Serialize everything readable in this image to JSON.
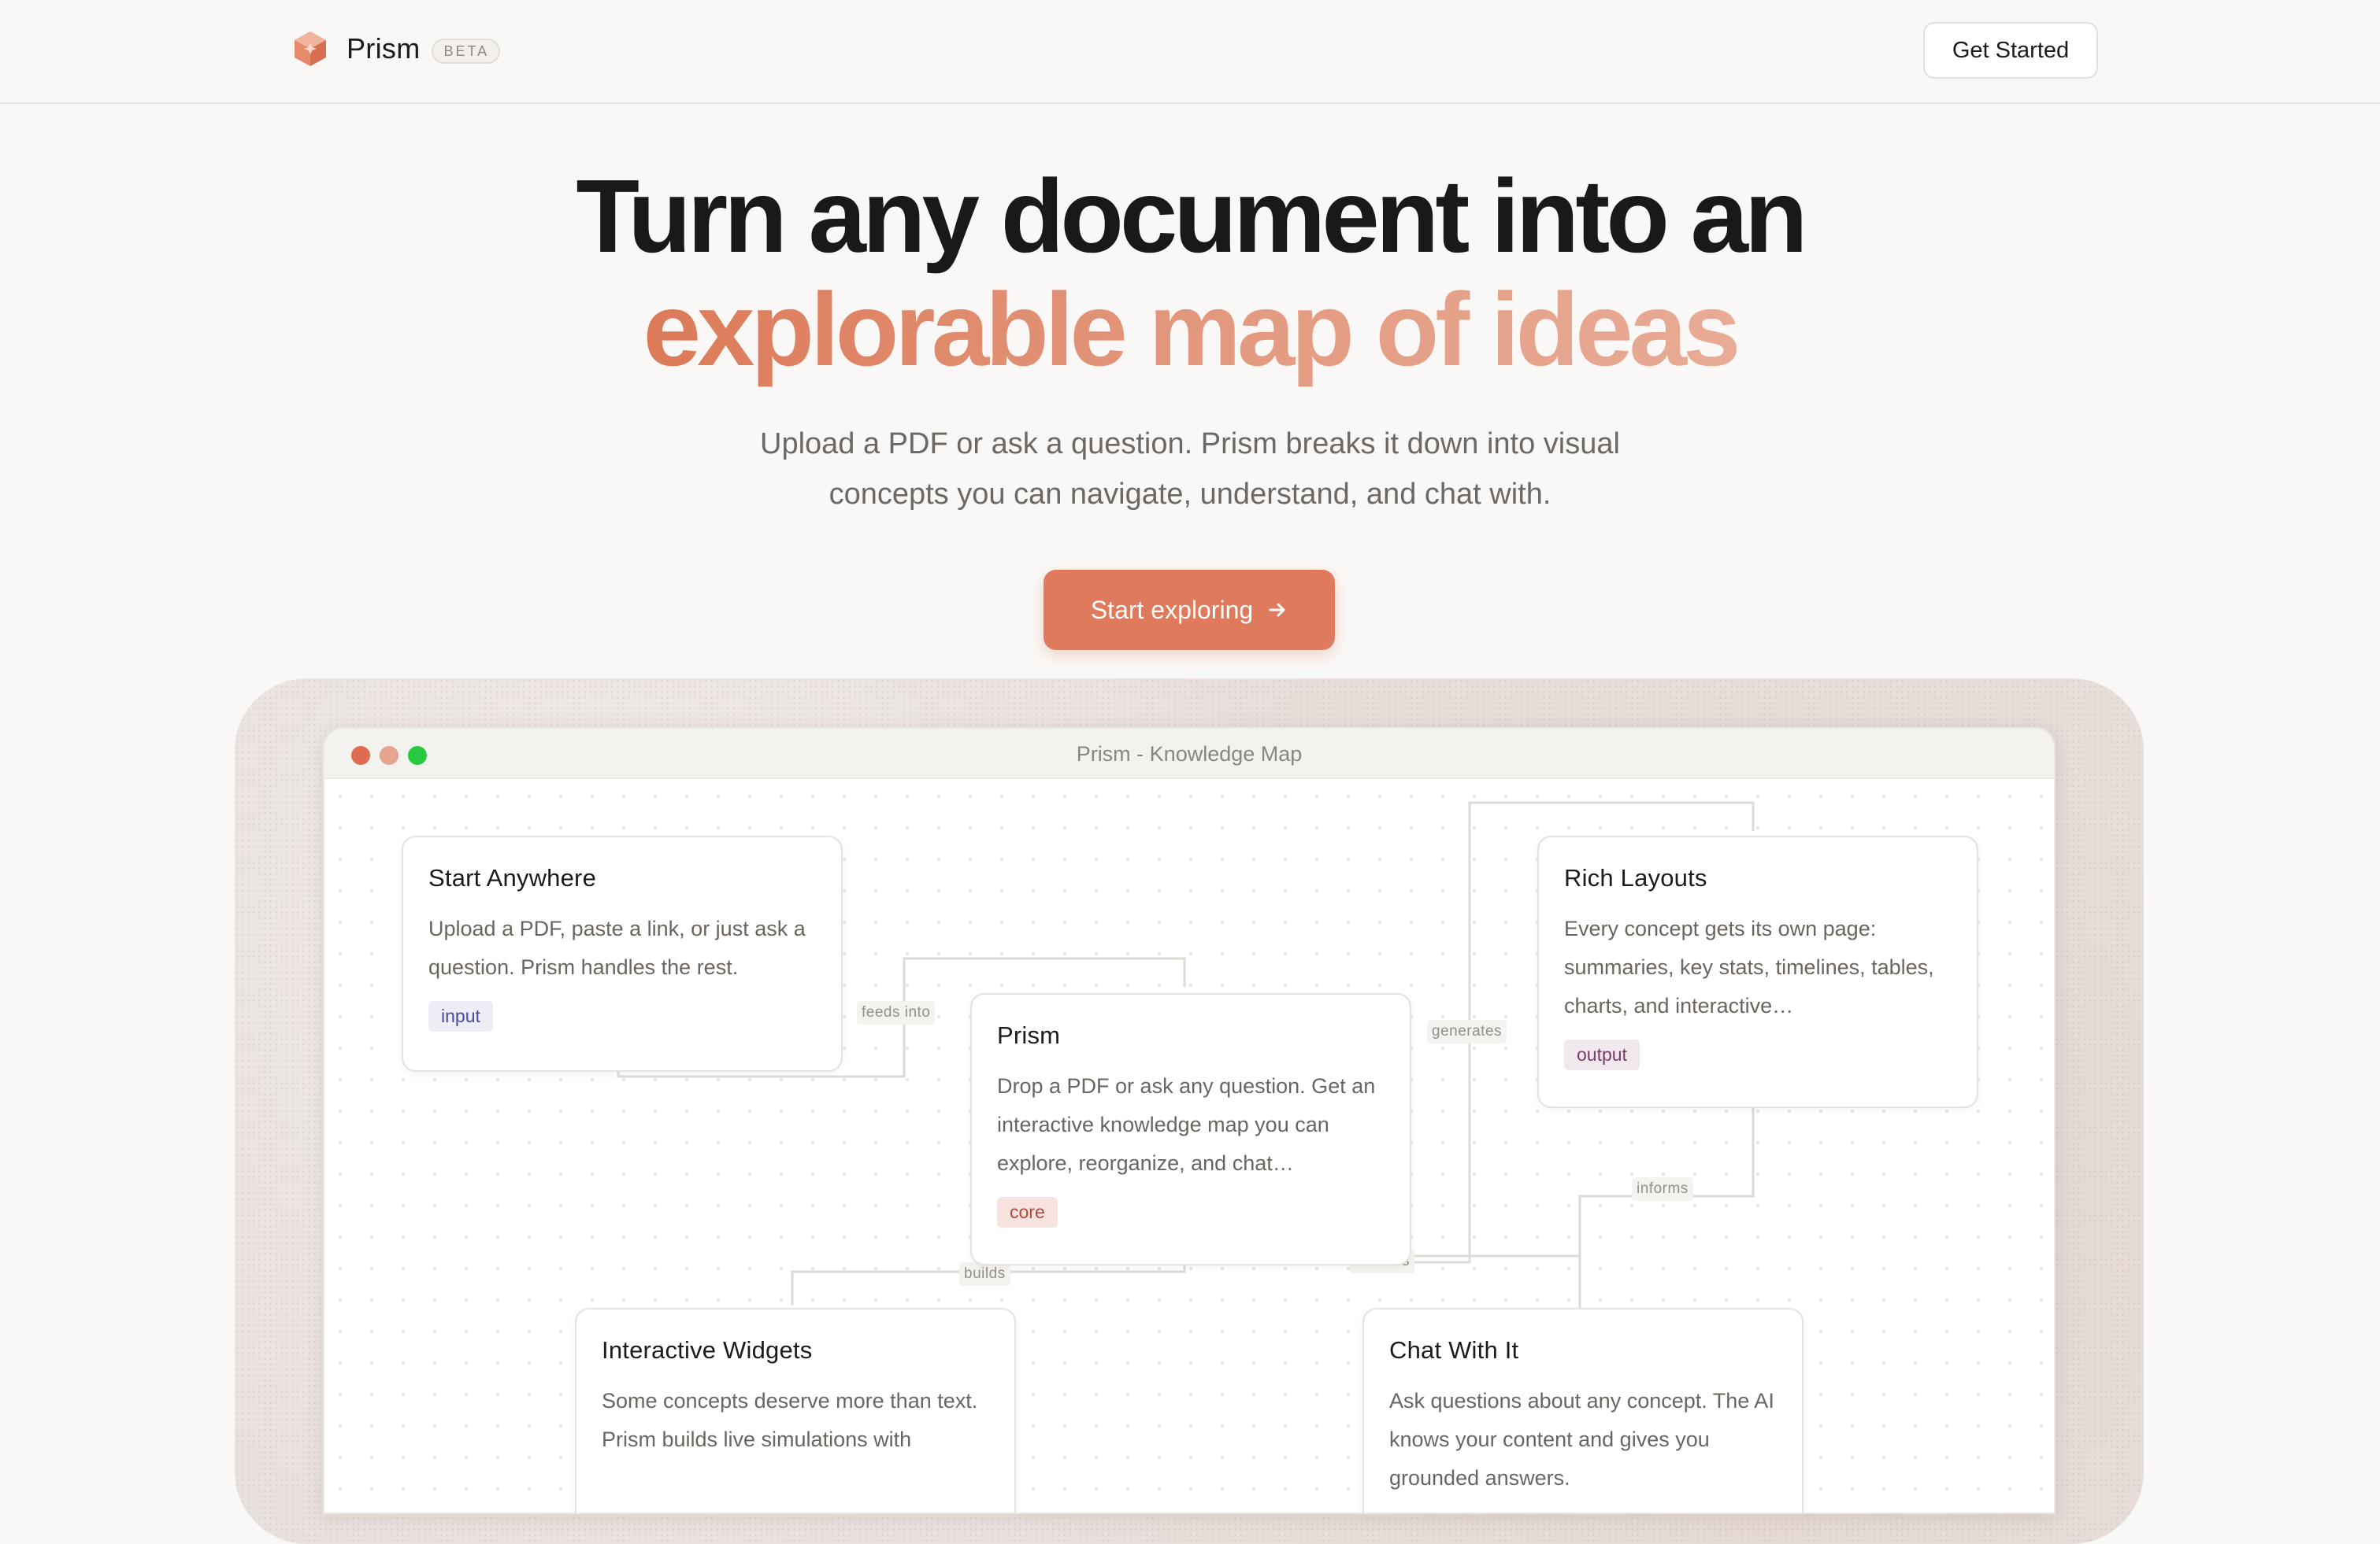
{
  "nav": {
    "brand_name": "Prism",
    "beta_label": "BETA",
    "get_started_label": "Get Started"
  },
  "hero": {
    "line1": "Turn any document into an",
    "line2": "explorable map of ideas",
    "subtitle_line1": "Upload a PDF or ask a question. Prism breaks it down into visual",
    "subtitle_line2": "concepts you can navigate, understand, and chat with.",
    "cta_label": "Start exploring",
    "cta_icon": "arrow-right-icon"
  },
  "window": {
    "title": "Prism - Knowledge Map",
    "controls": [
      "close",
      "minimize",
      "maximize"
    ]
  },
  "edges": {
    "feeds_into": "feeds into",
    "generates": "generates",
    "informs": "informs",
    "enables": "enables",
    "builds": "builds"
  },
  "cards": {
    "start_anywhere": {
      "title": "Start Anywhere",
      "body": "Upload a PDF, paste a link, or just ask a question. Prism handles the rest.",
      "tag": "input"
    },
    "prism": {
      "title": "Prism",
      "body": "Drop a PDF or ask any question. Get an interactive knowledge map you can explore, reorganize, and chat…",
      "tag": "core"
    },
    "rich_layouts": {
      "title": "Rich Layouts",
      "body": "Every concept gets its own page: summaries, key stats, timelines, tables, charts, and interactive…",
      "tag": "output"
    },
    "interactive_widgets": {
      "title": "Interactive Widgets",
      "body": "Some concepts deserve more than text. Prism builds live simulations with"
    },
    "chat_with_it": {
      "title": "Chat With It",
      "body": "Ask questions about any concept. The AI knows your content and gives you grounded answers."
    }
  },
  "colors": {
    "accent": "#df7a5c",
    "accent_light": "#e8ab95",
    "background": "#faf8f6",
    "tag_input": "#4b47a3",
    "tag_core": "#b04a3c",
    "tag_output": "#7a3a6b"
  }
}
